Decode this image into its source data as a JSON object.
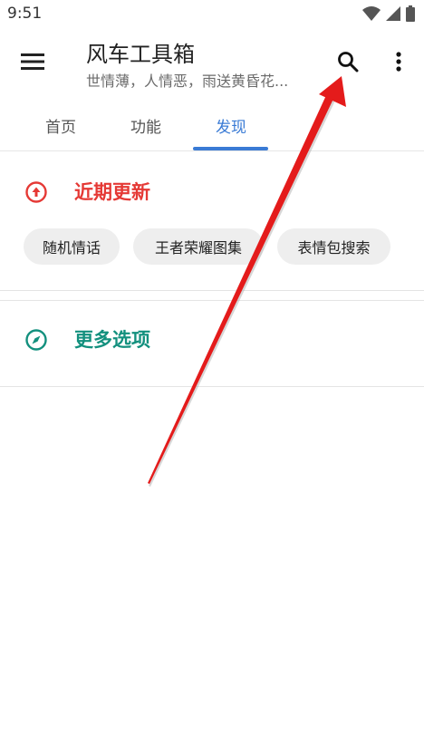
{
  "status": {
    "time": "9:51"
  },
  "header": {
    "title": "风车工具箱",
    "subtitle": "世情薄，人情恶，雨送黄昏花..."
  },
  "tabs": [
    {
      "label": "首页",
      "active": false
    },
    {
      "label": "功能",
      "active": false
    },
    {
      "label": "发现",
      "active": true
    }
  ],
  "sections": {
    "recent": {
      "title": "近期更新",
      "color": "#e53935",
      "chips": [
        "随机情话",
        "王者荣耀图集",
        "表情包搜索"
      ]
    },
    "more": {
      "title": "更多选项",
      "color": "#13907e"
    }
  },
  "colors": {
    "accent": "#3a7bd5",
    "chip_bg": "#eeeeee",
    "arrow": "#e41b1b"
  },
  "icons": {
    "menu": "hamburger-menu-icon",
    "search": "search-icon",
    "more": "more-vert-icon",
    "recent": "arrow-up-circle-icon",
    "more_options": "compass-icon"
  }
}
